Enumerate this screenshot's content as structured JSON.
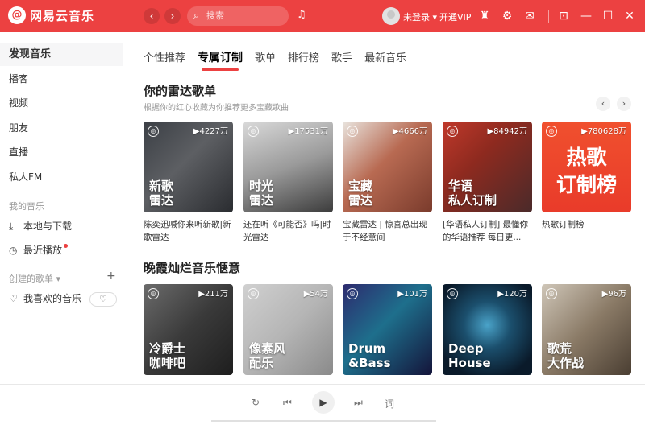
{
  "app": {
    "title": "网易云音乐",
    "logo_glyph": "@",
    "accent": "#ec4141"
  },
  "header": {
    "back_icon": "‹",
    "forward_icon": "›",
    "search_placeholder": "搜索",
    "search_icon": "⌕",
    "mic_icon": "♫",
    "login_label": "未登录 ▾",
    "vip_label": "开通VIP",
    "icons": {
      "skin": "♜",
      "settings": "⚙",
      "mail": "✉",
      "miniplayer": "⊡",
      "minimize": "—",
      "maximize": "☐",
      "close": "✕"
    }
  },
  "sidebar": {
    "items": [
      {
        "label": "发现音乐"
      },
      {
        "label": "播客"
      },
      {
        "label": "视频"
      },
      {
        "label": "朋友"
      },
      {
        "label": "直播"
      },
      {
        "label": "私人FM"
      }
    ],
    "my_music_title": "我的音乐",
    "my_music": [
      {
        "label": "本地与下载",
        "icon": "⤓"
      },
      {
        "label": "最近播放",
        "icon": "◷"
      }
    ],
    "created_title": "创建的歌单 ▾",
    "created_add": "+",
    "liked_label": "我喜欢的音乐",
    "liked_icon": "♡",
    "heart_mode_icon": "♡"
  },
  "tabs": [
    {
      "label": "个性推荐"
    },
    {
      "label": "专属订制"
    },
    {
      "label": "歌单"
    },
    {
      "label": "排行榜"
    },
    {
      "label": "歌手"
    },
    {
      "label": "最新音乐"
    }
  ],
  "radar": {
    "title": "你的雷达歌单",
    "subtitle": "根据你的红心收藏为你推荐更多宝藏歌曲",
    "prev": "‹",
    "next": "›",
    "cards": [
      {
        "count": "▶4227万",
        "cover": "新歌\n雷达",
        "text": "陈奕迅喊你来听新歌|新歌雷达",
        "mark": "◎"
      },
      {
        "count": "▶17531万",
        "cover": "时光\n雷达",
        "text": "还在听《可能否》吗|时光雷达",
        "mark": "◎"
      },
      {
        "count": "▶4666万",
        "cover": "宝藏\n雷达",
        "text": "宝藏雷达 | 惊喜总出现于不经意间",
        "mark": "◎"
      },
      {
        "count": "▶84942万",
        "cover": "华语\n私人订制",
        "text": "[华语私人订制] 最懂你的华语推荐 每日更...",
        "mark": "◎"
      },
      {
        "count": "▶780628万",
        "cover": "热歌\n订制榜",
        "text": "热歌订制榜",
        "mark": "◎"
      }
    ]
  },
  "sunset": {
    "title": "晚霞灿烂音乐惬意",
    "cards": [
      {
        "count": "▶211万",
        "cover": "冷爵士\n咖啡吧",
        "mark": "◎"
      },
      {
        "count": "▶54万",
        "cover": "像素风\n配乐",
        "mark": "◎"
      },
      {
        "count": "▶101万",
        "cover": "Drum\n&Bass",
        "mark": "◎"
      },
      {
        "count": "▶120万",
        "cover": "Deep\nHouse",
        "mark": "◎"
      },
      {
        "count": "▶96万",
        "cover": "歌荒\n大作战",
        "mark": "◎"
      }
    ]
  },
  "player": {
    "loop_icon": "↻",
    "prev_icon": "⏮",
    "play_icon": "▶",
    "next_icon": "⏭",
    "lyrics_label": "词"
  }
}
